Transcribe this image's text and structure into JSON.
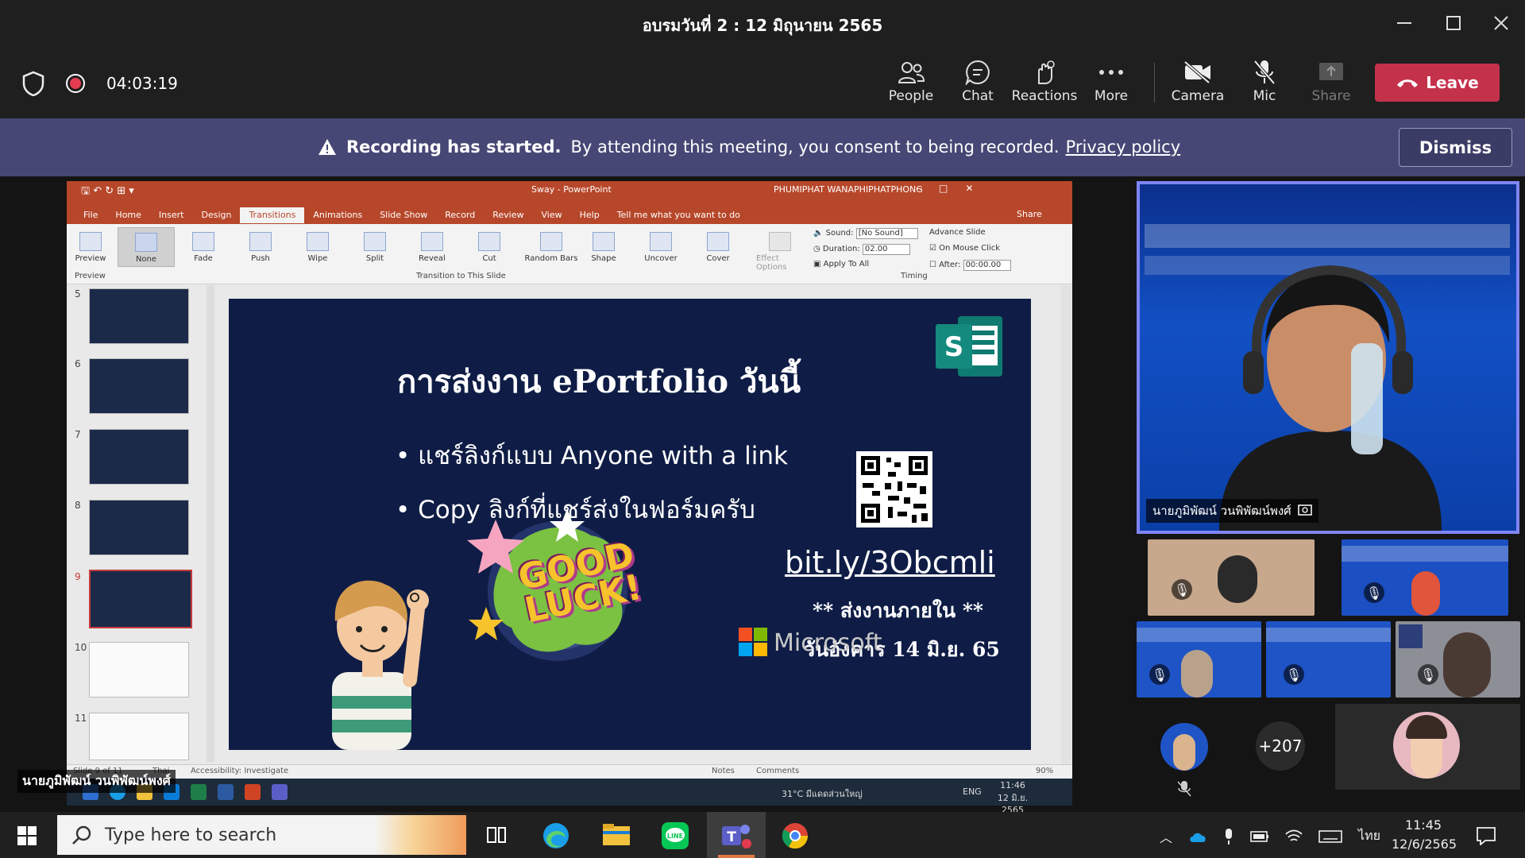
{
  "window": {
    "title": "อบรมวันที่ 2 : 12 มิถุนายน 2565"
  },
  "meeting": {
    "timer": "04:03:19",
    "tools": [
      {
        "label": "People",
        "icon": "people-icon"
      },
      {
        "label": "Chat",
        "icon": "chat-icon"
      },
      {
        "label": "Reactions",
        "icon": "reactions-icon"
      },
      {
        "label": "More",
        "icon": "more-icon"
      },
      {
        "label": "Camera",
        "icon": "camera-off-icon"
      },
      {
        "label": "Mic",
        "icon": "mic-off-icon"
      },
      {
        "label": "Share",
        "icon": "share-icon"
      }
    ],
    "leave_label": "Leave"
  },
  "banner": {
    "title": "Recording has started.",
    "text": "By attending this meeting, you consent to being recorded.",
    "link": "Privacy policy",
    "dismiss": "Dismiss"
  },
  "ppt": {
    "doc_title": "Sway  -  PowerPoint",
    "user": "PHUMIPHAT WANAPHIPHATPHONG",
    "tabs": [
      "File",
      "Home",
      "Insert",
      "Design",
      "Transitions",
      "Animations",
      "Slide Show",
      "Record",
      "Review",
      "View",
      "Help",
      "Tell me what you want to do"
    ],
    "share": "Share",
    "preview": "Preview",
    "transitions": [
      "None",
      "Fade",
      "Push",
      "Wipe",
      "Split",
      "Reveal",
      "Cut",
      "Random Bars",
      "Shape",
      "Uncover",
      "Cover"
    ],
    "effect_options": "Effect Options",
    "group_preview": "Preview",
    "group_transition": "Transition to This Slide",
    "group_timing": "Timing",
    "sound_label": "Sound:",
    "sound_value": "[No Sound]",
    "duration_label": "Duration:",
    "duration_value": "02.00",
    "apply_all": "Apply To All",
    "advance_slide": "Advance Slide",
    "on_mouse_click": "On Mouse Click",
    "after_label": "After:",
    "after_value": "00:00.00",
    "slide_numbers": [
      "5",
      "6",
      "7",
      "8",
      "9",
      "10",
      "11"
    ],
    "status_left": "Slide 9 of 11",
    "status_lang": "Thai",
    "status_access": "Accessibility: Investigate",
    "status_notes": "Notes",
    "status_comments": "Comments",
    "zoom": "90%"
  },
  "slide": {
    "title": "การส่งงาน ePortfolio วันนี้",
    "bullets": [
      "แชร์ลิงก์แบบ Anyone with a link",
      "Copy ลิงก์ที่แชร์ส่งในฟอร์มครับ"
    ],
    "link": "bit.ly/3Obcmli",
    "deadline1": "** ส่งงานภายใน **",
    "deadline2": "วันอังคาร  14 มิ.ย. 65",
    "good_luck": "GOOD LUCK!",
    "microsoft": "Microsoft"
  },
  "inner_taskbar": {
    "weather": "31°C  มีแดดส่วนใหญ่",
    "lang": "ENG",
    "time": "11:46",
    "date": "12 มิ.ย. 2565"
  },
  "presenter_name": "นายภูมิพัฒน์ วนพิพัฒน์พงศ์",
  "participants": {
    "speaker_name": "นายภูมิพัฒน์ วนพิพัฒน์พงศ์",
    "overflow": "+207"
  },
  "taskbar": {
    "search_placeholder": "Type here to search",
    "lang": "ไทย",
    "time": "11:45",
    "date": "12/6/2565"
  }
}
